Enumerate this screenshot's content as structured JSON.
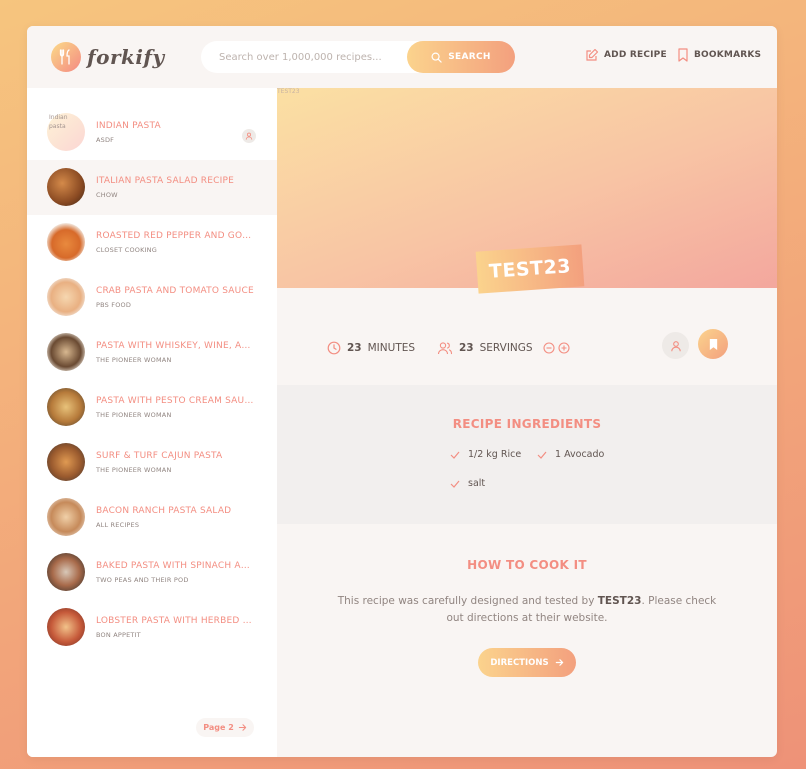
{
  "brand": {
    "name": "forkify",
    "accent": "#f38e82",
    "gradient": [
      "#fbdb89",
      "#f48982"
    ]
  },
  "search": {
    "placeholder": "Search over 1,000,000 recipes...",
    "button_label": "SEARCH"
  },
  "nav": {
    "add_recipe": "ADD RECIPE",
    "bookmarks": "BOOKMARKS"
  },
  "results": [
    {
      "title": "INDIAN PASTA",
      "publisher": "ASDF",
      "image_alt": "Indian pasta",
      "user_generated": true,
      "thumb": "placeholder"
    },
    {
      "title": "ITALIAN PASTA SALAD RECIPE",
      "publisher": "CHOW",
      "active": true,
      "thumb": "food"
    },
    {
      "title": "ROASTED RED PEPPER AND GOA...",
      "publisher": "CLOSET COOKING",
      "thumb": "food"
    },
    {
      "title": "CRAB PASTA AND TOMATO SAUCE",
      "publisher": "PBS FOOD",
      "thumb": "food"
    },
    {
      "title": "PASTA WITH WHISKEY, WINE, AN...",
      "publisher": "THE PIONEER WOMAN",
      "thumb": "food"
    },
    {
      "title": "PASTA WITH PESTO CREAM SAUCE",
      "publisher": "THE PIONEER WOMAN",
      "thumb": "food"
    },
    {
      "title": "SURF & TURF CAJUN PASTA",
      "publisher": "THE PIONEER WOMAN",
      "thumb": "food"
    },
    {
      "title": "BACON RANCH PASTA SALAD",
      "publisher": "ALL RECIPES",
      "thumb": "food"
    },
    {
      "title": "BAKED PASTA WITH SPINACH AN...",
      "publisher": "TWO PEAS AND THEIR POD",
      "thumb": "food"
    },
    {
      "title": "LOBSTER PASTA WITH HERBED C...",
      "publisher": "BON APPETIT",
      "thumb": "food"
    }
  ],
  "pagination": {
    "next_label": "Page 2"
  },
  "recipe": {
    "image_alt": "TEST23",
    "title": "TEST23",
    "minutes": "23",
    "minutes_label": "MINUTES",
    "servings": "23",
    "servings_label": "SERVINGS",
    "ingredients_heading": "RECIPE INGREDIENTS",
    "ingredients": [
      "1/2 kg Rice",
      "1 Avocado",
      "salt"
    ],
    "cook_heading": "HOW TO COOK IT",
    "cook_text_before": "This recipe was carefully designed and tested by ",
    "cook_publisher": "TEST23",
    "cook_text_after": ". Please check out directions at their website.",
    "directions_label": "DIRECTIONS"
  }
}
